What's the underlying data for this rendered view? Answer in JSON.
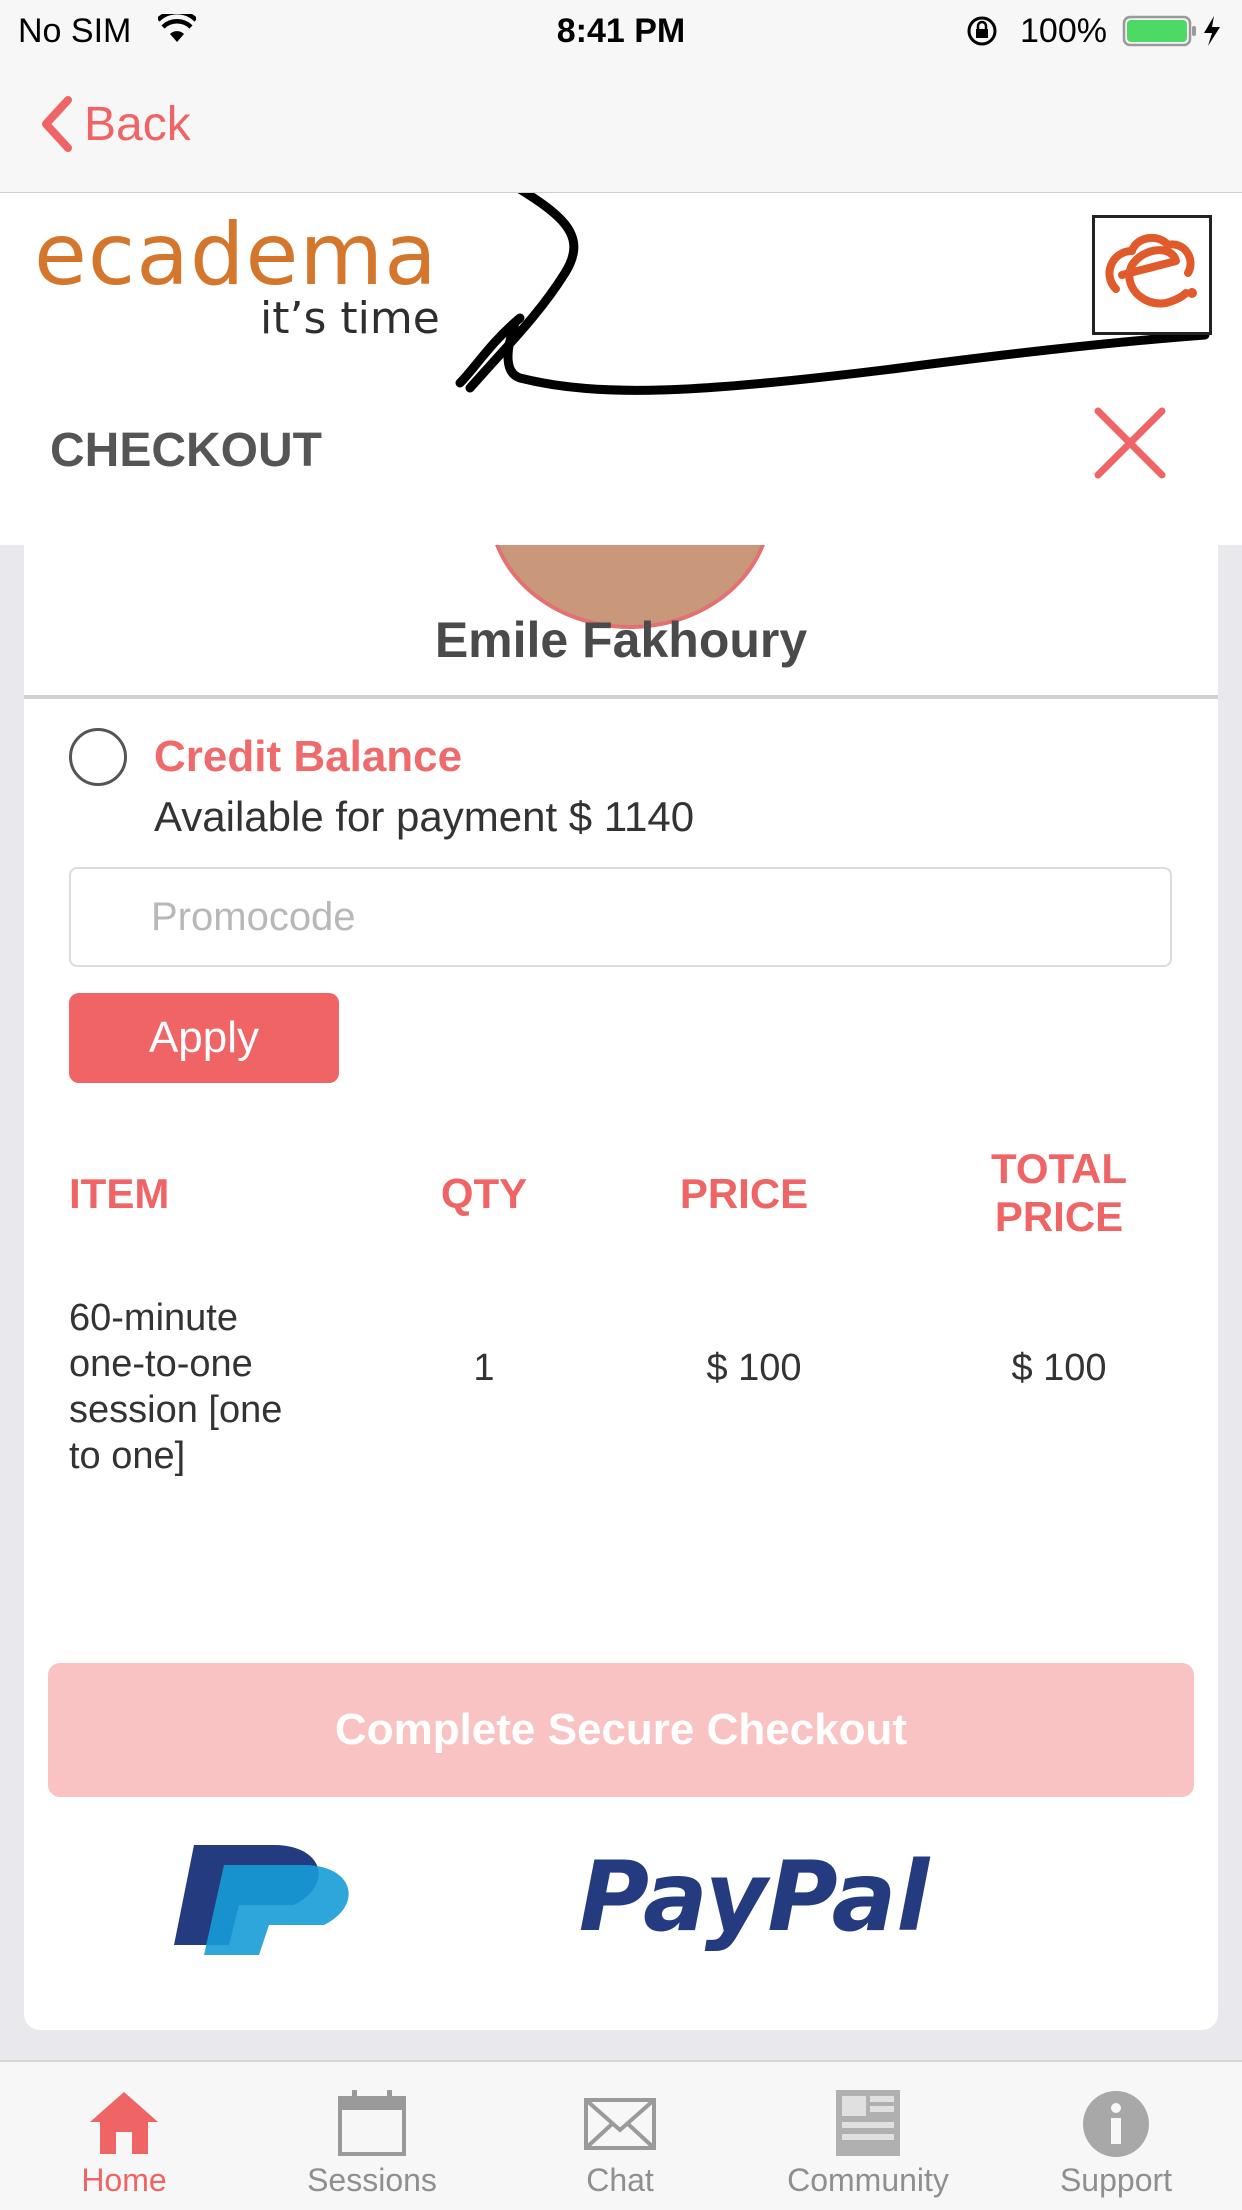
{
  "status_bar": {
    "carrier": "No SIM",
    "time": "8:41 PM",
    "battery": "100%"
  },
  "nav": {
    "back_label": "Back"
  },
  "header": {
    "brand": "ecadema",
    "tagline": "it’s time",
    "title": "CHECKOUT"
  },
  "profile": {
    "name": "Emile Fakhoury"
  },
  "credit": {
    "label": "Credit Balance",
    "available": "Available for payment $ 1140"
  },
  "promo": {
    "placeholder": "Promocode",
    "value": ""
  },
  "apply_label": "Apply",
  "table": {
    "headers": [
      "ITEM",
      "QTY",
      "PRICE",
      "TOTAL PRICE"
    ],
    "rows": [
      {
        "item": "60-minute one-to-one session [one to one]",
        "qty": "1",
        "price": "$ 100",
        "total": "$ 100"
      }
    ]
  },
  "checkout_label": "Complete Secure Checkout",
  "payment_brand": "PayPal",
  "tabs": [
    {
      "label": "Home",
      "icon": "home-icon",
      "active": true
    },
    {
      "label": "Sessions",
      "icon": "calendar-icon",
      "active": false
    },
    {
      "label": "Chat",
      "icon": "envelope-icon",
      "active": false
    },
    {
      "label": "Community",
      "icon": "newspaper-icon",
      "active": false
    },
    {
      "label": "Support",
      "icon": "info-icon",
      "active": false
    }
  ],
  "colors": {
    "accent": "#ef6464",
    "disabled_button": "#f9c3c3",
    "brand_orange": "#d4772d",
    "paypal_dark": "#253b80",
    "paypal_light": "#179bd7"
  }
}
